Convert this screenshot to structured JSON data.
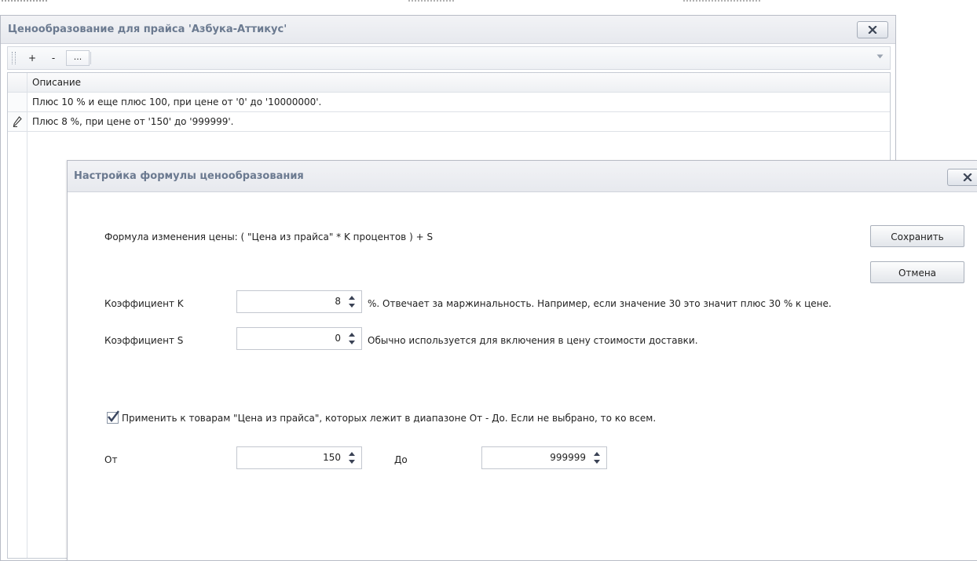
{
  "outer_window": {
    "title": "Ценообразование для прайса 'Азбука-Аттикус'",
    "toolbar": {
      "add_label": "+",
      "remove_label": "-",
      "more_label": "..."
    },
    "grid": {
      "column_header": "Описание",
      "rows": [
        {
          "description": "Плюс 10 % и еще плюс 100, при цене от '0' до '10000000'."
        },
        {
          "description": "Плюс 8 %, при цене от '150' до '999999'."
        }
      ]
    }
  },
  "dialog": {
    "title": "Настройка формулы ценообразования",
    "formula_text": "Формула изменения цены:  ( \"Цена из прайса\" * K процентов ) + S",
    "save_label": "Сохранить",
    "cancel_label": "Отмена",
    "coef_k": {
      "label": "Коэффициент K",
      "value": "8",
      "hint": "%. Отвечает за маржинальность. Например, если значение 30 это значит плюс 30 % к цене."
    },
    "coef_s": {
      "label": "Коэффициент S",
      "value": "0",
      "hint": "Обычно используется для включения в цену стоимости доставки."
    },
    "range_checkbox": {
      "checked": true,
      "label": "Применить к товарам \"Цена из прайса\", которых лежит в диапазоне От - До. Если не выбрано, то ко всем."
    },
    "from": {
      "label": "От",
      "value": "150"
    },
    "to": {
      "label": "До",
      "value": "999999"
    }
  },
  "colors": {
    "title_text": "#6b7a90",
    "border": "#b8bcc6",
    "checkmark": "#3a4660"
  }
}
